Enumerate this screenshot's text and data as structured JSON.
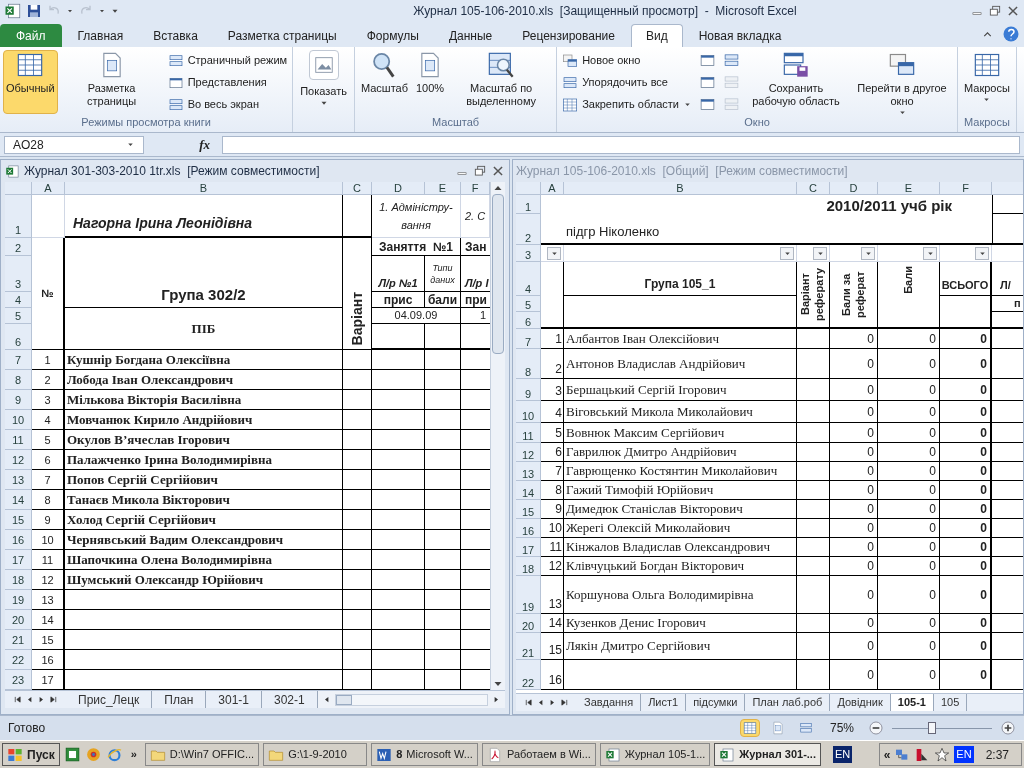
{
  "window": {
    "title": "Журнал 105-106-2010.xls  [Защищенный просмотр]  -  Microsoft Excel"
  },
  "tabs": [
    {
      "label": "Файл",
      "kind": "file",
      "selected": false
    },
    {
      "label": "Главная",
      "kind": "tab",
      "selected": false
    },
    {
      "label": "Вставка",
      "kind": "tab",
      "selected": false
    },
    {
      "label": "Разметка страницы",
      "kind": "tab",
      "selected": false
    },
    {
      "label": "Формулы",
      "kind": "tab",
      "selected": false
    },
    {
      "label": "Данные",
      "kind": "tab",
      "selected": false
    },
    {
      "label": "Рецензирование",
      "kind": "tab",
      "selected": false
    },
    {
      "label": "Вид",
      "kind": "tab",
      "selected": true
    },
    {
      "label": "Новая вкладка",
      "kind": "tab",
      "selected": false
    }
  ],
  "ribbon": {
    "groups": [
      {
        "label": "Режимы просмотра книги",
        "items": [
          {
            "label": "Обычный",
            "kind": "large",
            "selected": true,
            "dropdown": false
          },
          {
            "label": "Разметка страницы",
            "kind": "large",
            "selected": false,
            "dropdown": false
          },
          {
            "label": "Страничный режим",
            "kind": "small",
            "selected": false,
            "dropdown": false
          },
          {
            "label": "Представления",
            "kind": "small",
            "selected": false,
            "dropdown": false
          },
          {
            "label": "Во весь экран",
            "kind": "small",
            "selected": false,
            "dropdown": false
          }
        ]
      },
      {
        "items": [
          {
            "label": "Показать",
            "kind": "boxed",
            "selected": false,
            "dropdown": true
          }
        ]
      },
      {
        "label": "Масштаб",
        "items": [
          {
            "label": "Масштаб",
            "kind": "large",
            "selected": false,
            "dropdown": false
          },
          {
            "label": "100%",
            "kind": "large",
            "selected": false,
            "dropdown": false
          },
          {
            "label": "Масштаб по выделенному",
            "kind": "large",
            "selected": false,
            "dropdown": false
          }
        ]
      },
      {
        "label": "Окно",
        "items": [
          {
            "label": "Новое окно",
            "kind": "small",
            "selected": false,
            "dropdown": false
          },
          {
            "label": "Упорядочить все",
            "kind": "small",
            "selected": false,
            "dropdown": false
          },
          {
            "label": "Закрепить области",
            "kind": "small",
            "selected": false,
            "dropdown": true
          },
          {
            "kind": "icon",
            "disabled": false
          },
          {
            "kind": "icon",
            "disabled": false
          },
          {
            "kind": "icon",
            "disabled": false
          },
          {
            "kind": "icon",
            "disabled": false
          },
          {
            "kind": "icon",
            "disabled": true
          },
          {
            "kind": "icon",
            "disabled": true
          },
          {
            "label": "Сохранить рабочую область",
            "kind": "large",
            "selected": false,
            "dropdown": false
          },
          {
            "label": "Перейти в другое окно",
            "kind": "large",
            "selected": false,
            "dropdown": true
          }
        ]
      },
      {
        "label": "Макросы",
        "items": [
          {
            "label": "Макросы",
            "kind": "large",
            "selected": false,
            "dropdown": true
          }
        ]
      }
    ]
  },
  "formula_bar": {
    "name_box": "AO28",
    "fx": "fx"
  },
  "left_window": {
    "title": "Журнал 301-303-2010 1tr.xls  [Режим совместимости]",
    "active": true,
    "columns": [
      "A",
      "B",
      "C",
      "D",
      "E",
      "F"
    ],
    "header_rows": [
      "1",
      "2",
      "3",
      "4",
      "5",
      "6"
    ],
    "header": {
      "teacher": "Нагорна Ірина Леонідівна",
      "topic_1": "1. Адміністру-вання",
      "topic_2": "2. С",
      "number": "№",
      "group": "Група 302/2",
      "pib": "ПІБ",
      "variant": "Варіант",
      "lesson_1": "Заняття  №1",
      "lesson_2": "Зан",
      "lab_1": "Л/р №1",
      "data_types": "Типи даних",
      "lab_2": "Л/р І",
      "presence_1": "прис",
      "points": "бали",
      "presence_2": "при",
      "date_1": "04.09.09",
      "date_2": "1"
    },
    "rows": [
      {
        "row": "7",
        "num": "1",
        "name": "Кушнір Богдана Олексіївна"
      },
      {
        "row": "8",
        "num": "2",
        "name": "Лобода Іван Олександрович"
      },
      {
        "row": "9",
        "num": "3",
        "name": "Мількова Вікторія Василівна"
      },
      {
        "row": "10",
        "num": "4",
        "name": "Мовчанюк Кирило Андрійович"
      },
      {
        "row": "11",
        "num": "5",
        "name": "Окулов В’ячеслав Ігорович"
      },
      {
        "row": "12",
        "num": "6",
        "name": "Палажченко Ірина Володимирівна"
      },
      {
        "row": "13",
        "num": "7",
        "name": "Попов Сергій Сергійович"
      },
      {
        "row": "14",
        "num": "8",
        "name": "Танаєв Микола Вікторович"
      },
      {
        "row": "15",
        "num": "9",
        "name": "Холод Сергій Сергійович"
      },
      {
        "row": "16",
        "num": "10",
        "name": "Чернявський Вадим Олександрович"
      },
      {
        "row": "17",
        "num": "11",
        "name": "Шапочкина Олена Володимирівна"
      },
      {
        "row": "18",
        "num": "12",
        "name": "Шумський Олександр Юрійович"
      },
      {
        "row": "19",
        "num": "13"
      },
      {
        "row": "20",
        "num": "14"
      },
      {
        "row": "21",
        "num": "15"
      },
      {
        "row": "22",
        "num": "16"
      },
      {
        "row": "23",
        "num": "17"
      }
    ],
    "sheet_tabs": [
      {
        "label": "Прис_Лецк",
        "selected": false
      },
      {
        "label": "План",
        "selected": false
      },
      {
        "label": "301-1",
        "selected": false
      },
      {
        "label": "302-1",
        "selected": false
      }
    ]
  },
  "right_window": {
    "title": "Журнал 105-106-2010.xls  [Общий]  [Режим совместимости]",
    "active": false,
    "columns": [
      "A",
      "B",
      "C",
      "D",
      "E",
      "F"
    ],
    "header_rows": [
      "1",
      "2",
      "3",
      "4",
      "5",
      "6"
    ],
    "header": {
      "year": "2010/2011 учб рік",
      "subgroup": "підгр Ніколенко",
      "group": "Група 105_1",
      "variant": "Варіант реферату",
      "essay_points": "Бали за реферат",
      "points": "Бали",
      "total": "ВСЬОГО",
      "next": "Л/",
      "next_sub": "п"
    },
    "rows": [
      {
        "row": "7",
        "num": "1",
        "name": "Албантов Іван Олексійович",
        "d": "0",
        "e": "0",
        "total": "0"
      },
      {
        "row": "8",
        "num": "2",
        "name": "Антонов Владислав Андрійович",
        "d": "0",
        "e": "0",
        "total": "0"
      },
      {
        "row": "9",
        "num": "3",
        "name": "Бершацький Сергій Ігорович",
        "d": "0",
        "e": "0",
        "total": "0"
      },
      {
        "row": "10",
        "num": "4",
        "name": "Віговський Микола Миколайович",
        "d": "0",
        "e": "0",
        "total": "0"
      },
      {
        "row": "11",
        "num": "5",
        "name": "Вовнюк Максим Сергійович",
        "d": "0",
        "e": "0",
        "total": "0"
      },
      {
        "row": "12",
        "num": "6",
        "name": "Гаврилюк Дмитро Андрійович",
        "d": "0",
        "e": "0",
        "total": "0"
      },
      {
        "row": "13",
        "num": "7",
        "name": "Гаврющенко Костянтин Миколайович",
        "d": "0",
        "e": "0",
        "total": "0"
      },
      {
        "row": "14",
        "num": "8",
        "name": "Гажий Тимофій Юрійович",
        "d": "0",
        "e": "0",
        "total": "0"
      },
      {
        "row": "15",
        "num": "9",
        "name": "Димедюк Станіслав Вікторович",
        "d": "0",
        "e": "0",
        "total": "0"
      },
      {
        "row": "16",
        "num": "10",
        "name": "Жерегі Олексій Миколайович",
        "d": "0",
        "e": "0",
        "total": "0"
      },
      {
        "row": "17",
        "num": "11",
        "name": "Кінжалов Владислав Олександрович",
        "d": "0",
        "e": "0",
        "total": "0"
      },
      {
        "row": "18",
        "num": "12",
        "name": "Клівчуцький Богдан Вікторович",
        "d": "0",
        "e": "0",
        "total": "0"
      },
      {
        "row": "19",
        "num": "13",
        "name": "Коршунова Ольга Володимирівна",
        "d": "0",
        "e": "0",
        "total": "0"
      },
      {
        "row": "20",
        "num": "14",
        "name": "Кузенков Денис Ігорович",
        "d": "0",
        "e": "0",
        "total": "0"
      },
      {
        "row": "21",
        "num": "15",
        "name": "Лякін Дмитро Сергійович",
        "d": "0",
        "e": "0",
        "total": "0"
      },
      {
        "row": "22",
        "num": "16",
        "d": "0",
        "e": "0",
        "total": "0"
      }
    ],
    "sheet_tabs": [
      {
        "label": "Завдання",
        "selected": false
      },
      {
        "label": "Лист1",
        "selected": false
      },
      {
        "label": "підсумки",
        "selected": false
      },
      {
        "label": "План лаб.роб",
        "selected": false
      },
      {
        "label": "Довідник",
        "selected": false
      },
      {
        "label": "105-1",
        "selected": true
      },
      {
        "label": "105",
        "selected": false
      }
    ]
  },
  "status_bar": {
    "status": "Готово",
    "views": [
      {
        "selected": true
      },
      {
        "selected": false
      },
      {
        "selected": false
      }
    ],
    "zoom": "75%",
    "zoom_slider": {
      "level": 0.4
    }
  },
  "taskbar": {
    "start": "Пуск",
    "more": "»",
    "tasks": [
      {
        "label": "D:\\Win7 OFFIC...",
        "kind": "folder",
        "selected": false
      },
      {
        "label": "G:\\1-9-2010",
        "kind": "folder",
        "selected": false
      },
      {
        "count": "8",
        "label": "Microsoft W...",
        "kind": "word",
        "selected": false
      },
      {
        "label": "Работаем в Wi...",
        "kind": "pdf",
        "selected": false
      },
      {
        "label": "Журнал 105-1...",
        "kind": "excel",
        "selected": false
      },
      {
        "label": "Журнал 301-...",
        "kind": "excel",
        "selected": true
      }
    ],
    "language": "EN",
    "collapse": "«",
    "tray_language": "EN",
    "clock": "2:37"
  }
}
